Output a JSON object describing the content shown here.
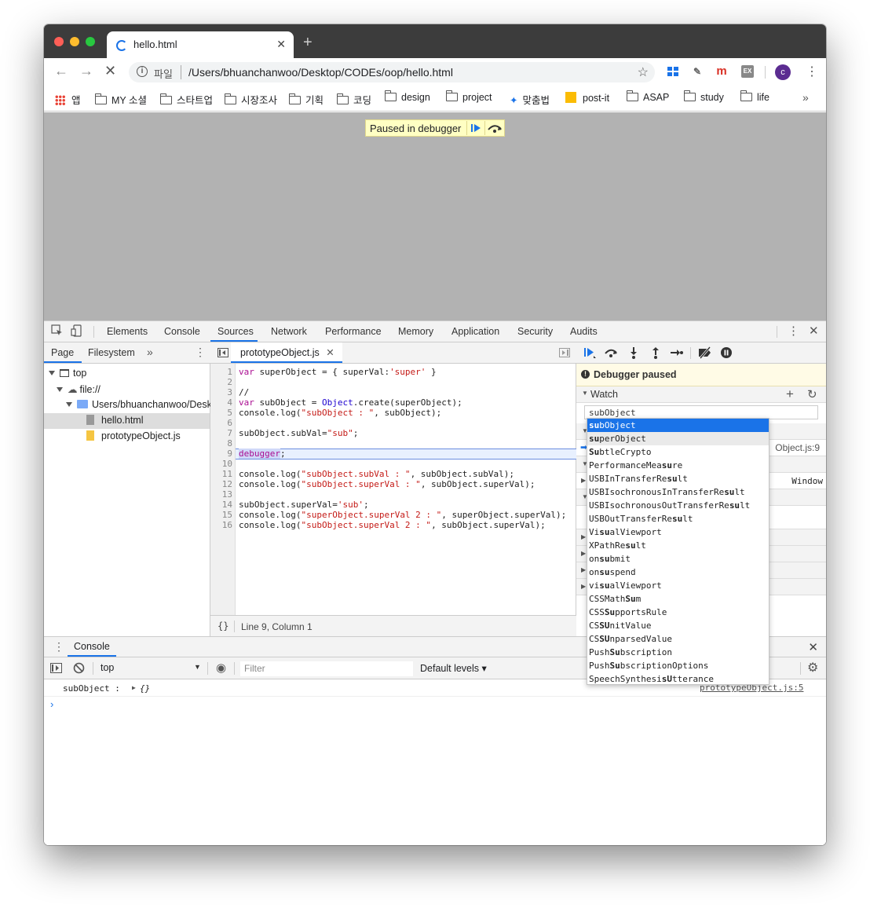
{
  "browser": {
    "tab_title": "hello.html",
    "new_tab": "+",
    "omnibox_scheme_label": "파일",
    "omnibox_url": "/Users/bhuanchanwoo/Desktop/CODEs/oop/hello.html",
    "avatar_letter": "c",
    "ext_m": "m",
    "ext_ex": "EX"
  },
  "bookmarks": {
    "items": [
      "앱",
      "MY 소셜",
      "스타트업",
      "시장조사",
      "기획",
      "코딩",
      "design",
      "project",
      "맞춤법",
      "post-it",
      "ASAP",
      "study",
      "life"
    ],
    "more": "»"
  },
  "page": {
    "paused_banner": "Paused in debugger"
  },
  "devtools": {
    "tabs": [
      "Elements",
      "Console",
      "Sources",
      "Network",
      "Performance",
      "Memory",
      "Application",
      "Security",
      "Audits"
    ],
    "active_tab": "Sources",
    "navigator": {
      "tabs": [
        "Page",
        "Filesystem"
      ],
      "more": "»",
      "tree": [
        "top",
        "file://",
        "Users/bhuanchanwoo/Deskt",
        "hello.html",
        "prototypeObject.js"
      ]
    },
    "editor": {
      "file_tab": "prototypeObject.js",
      "line_numbers": "1\n2\n3\n4\n5\n6\n7\n8\n9\n10\n11\n12\n13\n14\n15\n16",
      "status": "Line 9, Column 1",
      "format_btn": "{}"
    },
    "debugger": {
      "paused_title": "Debugger paused",
      "watch_label": "Watch",
      "watch_input": "subObject",
      "callstack_location": "Object.js:9",
      "scope_value": "Window"
    },
    "autocomplete": {
      "items": [
        "subObject",
        "superObject",
        "SubtleCrypto",
        "PerformanceMeasure",
        "USBInTransferResult",
        "USBIsochronousInTransferResult",
        "USBIsochronousOutTransferResult",
        "USBOutTransferResult",
        "VisualViewport",
        "XPathResult",
        "onsubmit",
        "onsuspend",
        "visualViewport",
        "CSSMathSum",
        "CSSSupportsRule",
        "CSSUnitValue",
        "CSSUnparsedValue",
        "PushSubscription",
        "PushSubscriptionOptions",
        "SpeechSynthesisUtterance"
      ],
      "selected_index": 0
    },
    "console": {
      "tab": "Console",
      "context": "top",
      "filter_placeholder": "Filter",
      "levels": "Default levels ▾",
      "log_text": "subObject :",
      "log_value": "{}",
      "log_source": "prototypeObject.js:5",
      "prompt": "›"
    }
  }
}
